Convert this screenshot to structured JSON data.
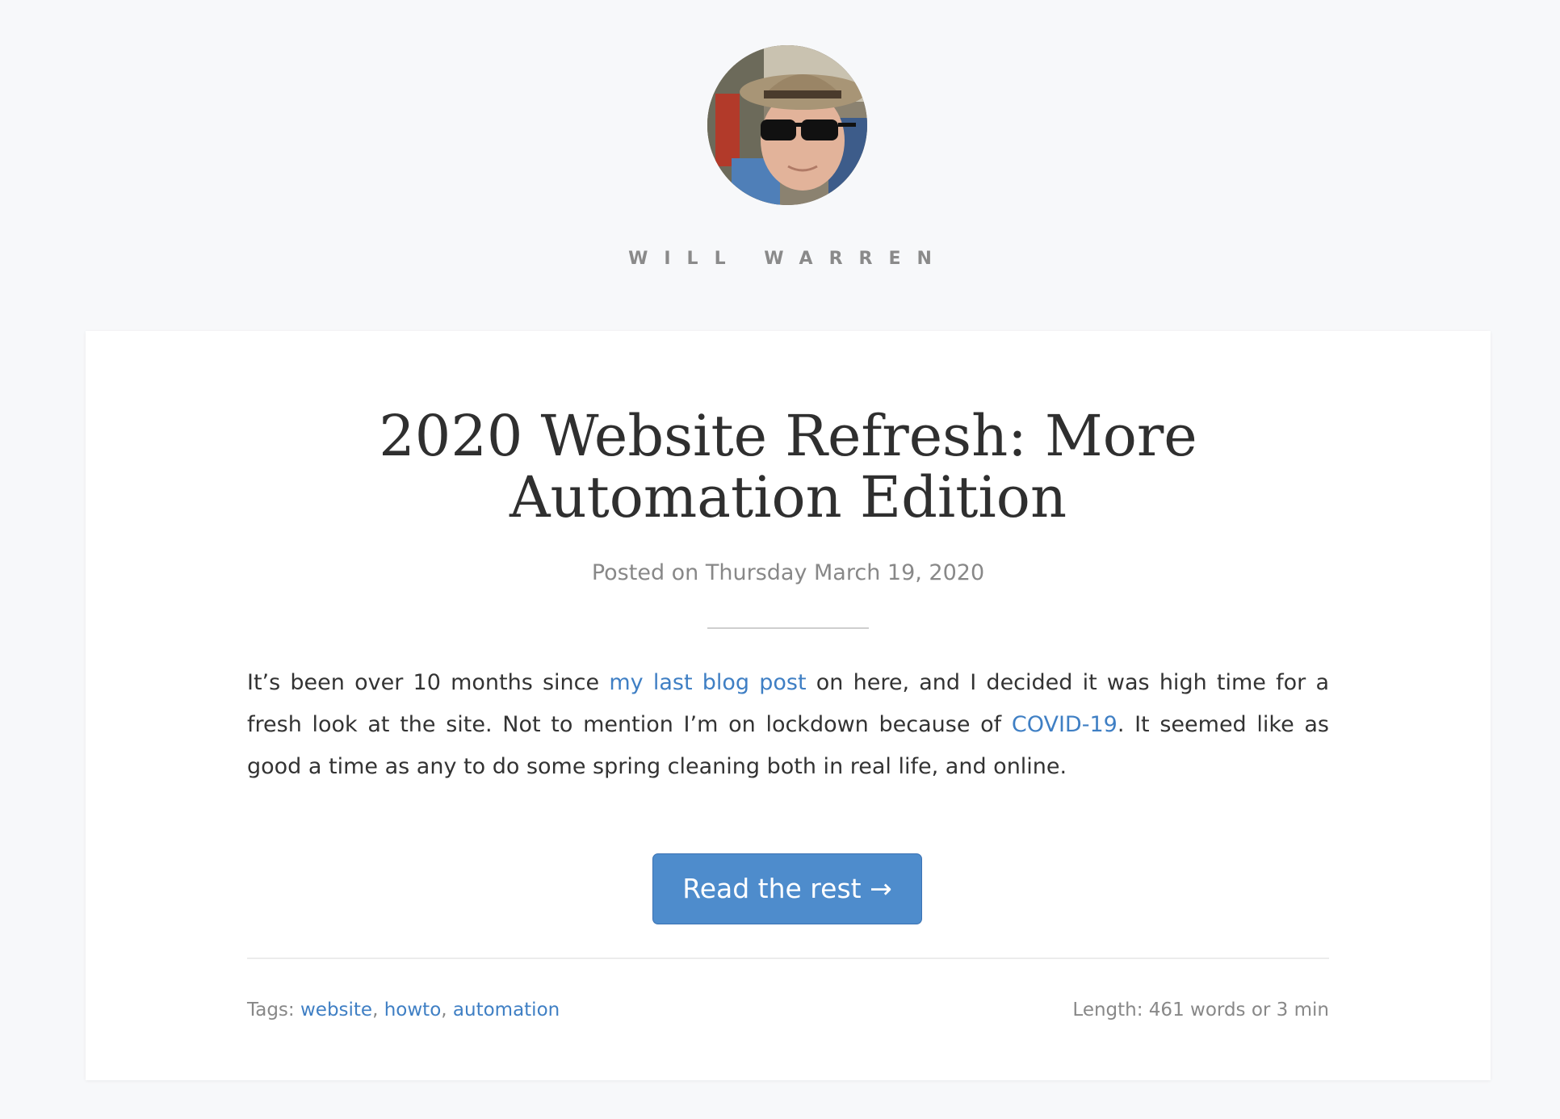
{
  "site": {
    "name": "WILL WARREN"
  },
  "post": {
    "title_line1": "2020 Website Refresh: More",
    "title_line2": "Automation Edition",
    "date": "Posted on Thursday March 19, 2020",
    "excerpt": {
      "text1": "It’s been over 10 months since ",
      "link1": "my last blog post",
      "text2": " on here, and I decided it was high time for a fresh look at the site. Not to mention I’m on lockdown because of ",
      "link2": "COVID-19",
      "text3": ". It seemed like as good a time as any to do some spring cleaning both in real life, and online."
    },
    "read_more_label": "Read the rest →",
    "tags_label": "Tags: ",
    "tags": [
      "website",
      "howto",
      "automation"
    ],
    "tag_separator": ", ",
    "length": "Length: 461 words or 3 min"
  },
  "colors": {
    "background": "#f7f8fa",
    "link": "#3f7fc4",
    "button": "#4e8ccc",
    "muted_text": "#888888"
  }
}
